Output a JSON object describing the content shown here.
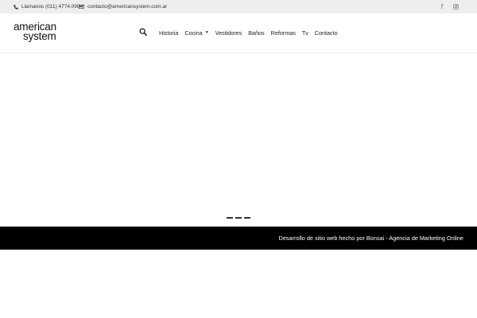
{
  "topbar": {
    "phone": {
      "icon": "phone-icon",
      "text": "Llamanos (011) 4774.0904"
    },
    "email": {
      "icon": "envelope-icon",
      "text": "contacto@americansystem.com.ar"
    },
    "social": [
      {
        "icon": "facebook-icon",
        "glyph": "f"
      },
      {
        "icon": "instagram-icon"
      }
    ]
  },
  "header": {
    "logo": {
      "line1": "american",
      "line2": "system"
    },
    "search_icon": "search-icon",
    "nav": [
      {
        "label": "Historia"
      },
      {
        "label": "Cocina",
        "dropdown": true
      },
      {
        "label": "Vestidores"
      },
      {
        "label": "Baños"
      },
      {
        "label": "Reformas"
      },
      {
        "label": "Tv"
      },
      {
        "label": "Contacto"
      }
    ]
  },
  "slider": {
    "dots": 3
  },
  "footer": {
    "credit": "Desarrollo de sitio web hecho por Bonsai - Agencia de Marketing Online"
  },
  "colors": {
    "topbar_bg": "#eeeeee",
    "footer_bg": "#000000",
    "text": "#222222"
  }
}
